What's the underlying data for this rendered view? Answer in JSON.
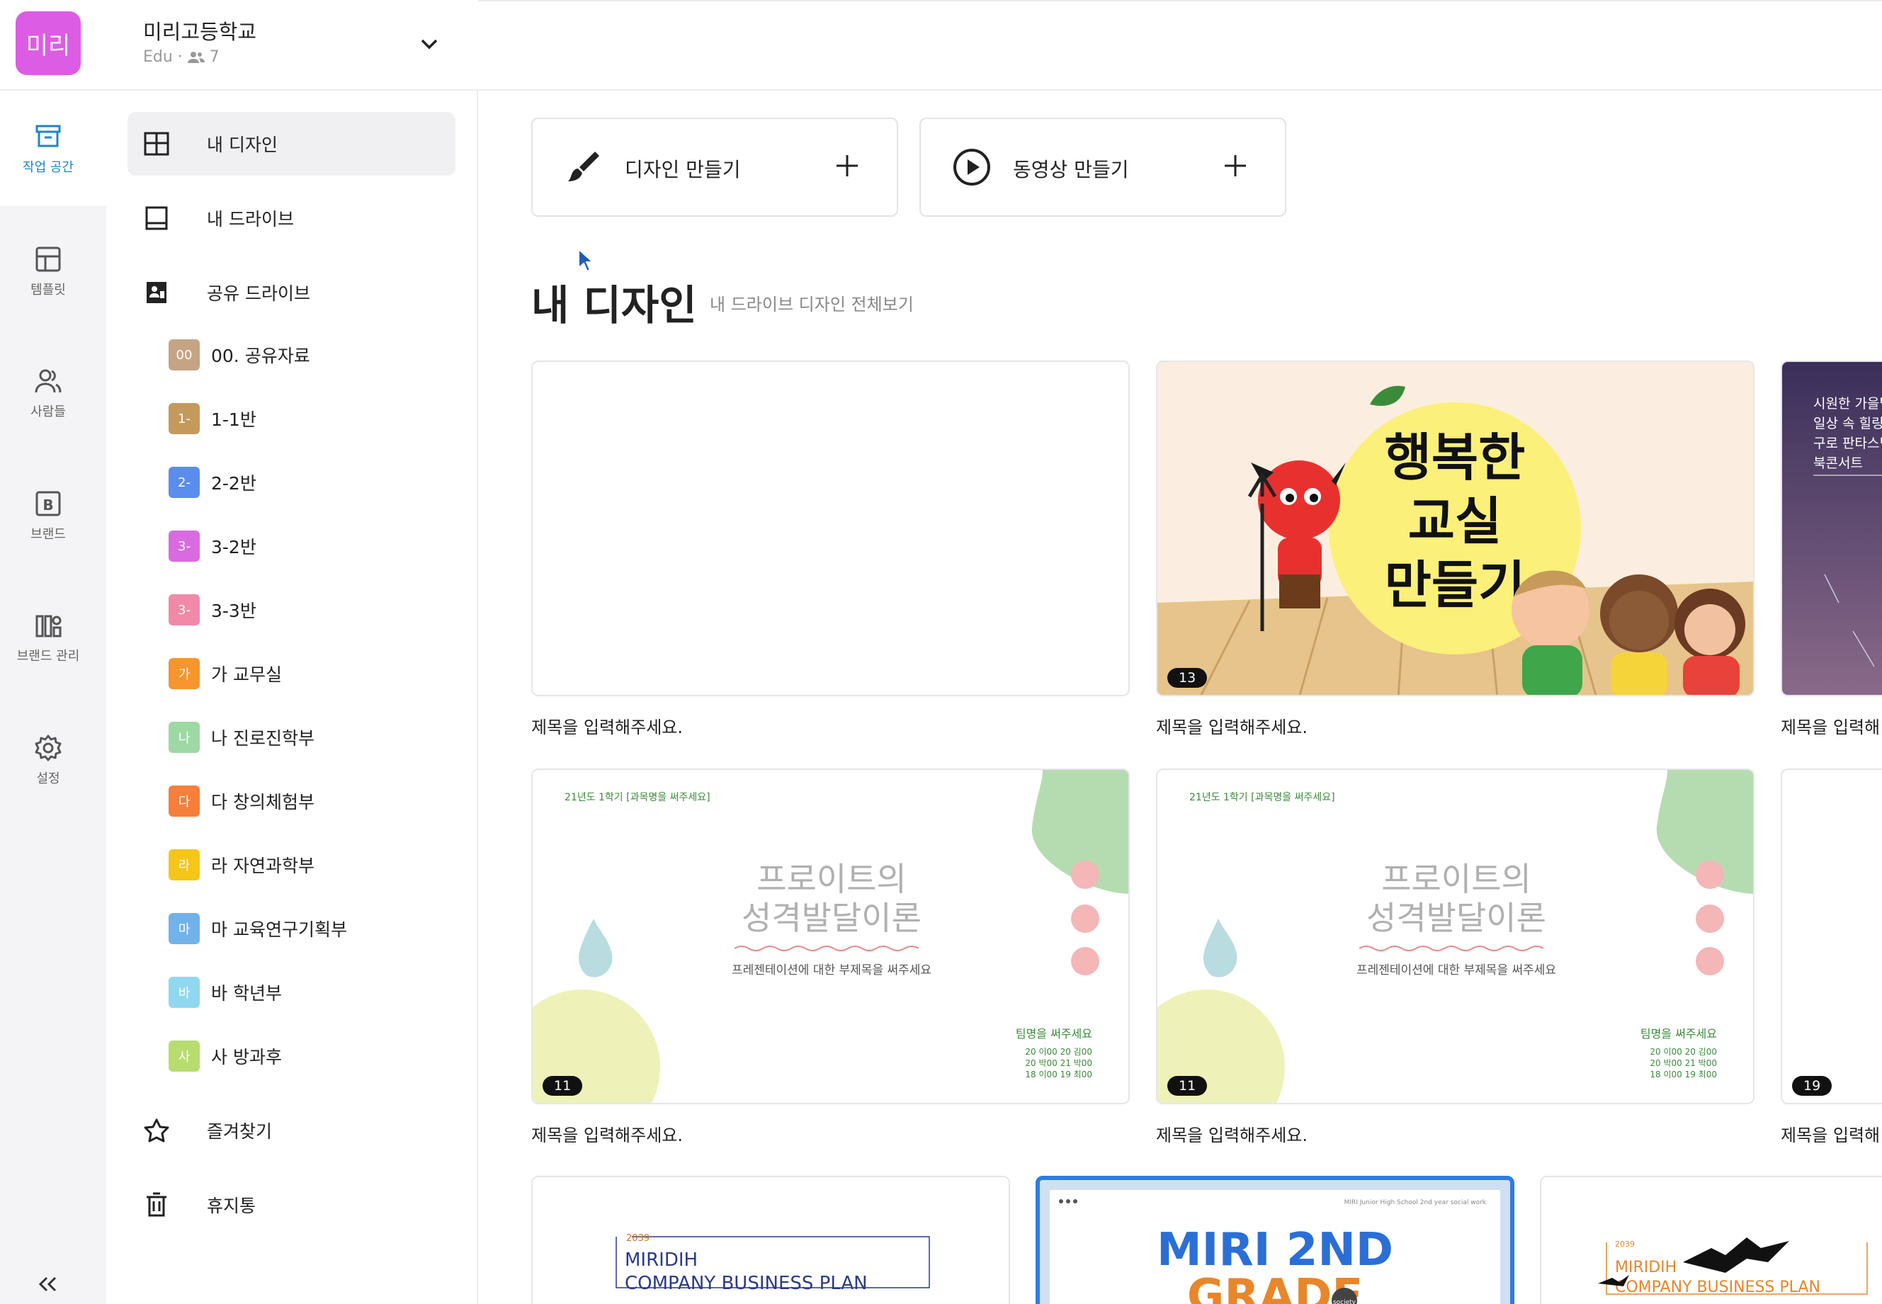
{
  "workspace": {
    "logo_text": "미리",
    "name": "미리고등학교",
    "plan": "Edu ·",
    "members": "7"
  },
  "rail": {
    "items": [
      {
        "label": "작업 공간",
        "icon": "archive-icon"
      },
      {
        "label": "템플릿",
        "icon": "template-icon"
      },
      {
        "label": "사람들",
        "icon": "people-icon"
      },
      {
        "label": "브랜드",
        "icon": "brand-b-icon"
      },
      {
        "label": "브랜드 관리",
        "icon": "brand-manage-icon"
      },
      {
        "label": "설정",
        "icon": "gear-icon"
      }
    ]
  },
  "nav": {
    "my_designs": "내 디자인",
    "my_drive": "내 드라이브",
    "shared_drive": "공유 드라이브",
    "favorites": "즐겨찾기",
    "trash": "휴지통",
    "folders": [
      {
        "badge": "00",
        "label": "00. 공유자료",
        "color": "#c4a484"
      },
      {
        "badge": "1-",
        "label": "1-1반",
        "color": "#c49a5c"
      },
      {
        "badge": "2-",
        "label": "2-2반",
        "color": "#5b8def"
      },
      {
        "badge": "3-",
        "label": "3-2반",
        "color": "#d86be0"
      },
      {
        "badge": "3-",
        "label": "3-3반",
        "color": "#f08aa8"
      },
      {
        "badge": "가",
        "label": "가 교무실",
        "color": "#f7952e"
      },
      {
        "badge": "나",
        "label": "나 진로진학부",
        "color": "#9ed8a4"
      },
      {
        "badge": "다",
        "label": "다 창의체험부",
        "color": "#f67f3c"
      },
      {
        "badge": "라",
        "label": "라 자연과학부",
        "color": "#f5c518"
      },
      {
        "badge": "마",
        "label": "마 교육연구기획부",
        "color": "#72b2ea"
      },
      {
        "badge": "바",
        "label": "바 학년부",
        "color": "#8fd8f0"
      },
      {
        "badge": "사",
        "label": "사 방과후",
        "color": "#b6dd6e"
      }
    ]
  },
  "main": {
    "create_design": "디자인 만들기",
    "create_video": "동영상 만들기",
    "section_title": "내 디자인",
    "section_link": "내 드라이브 디자인 전체보기",
    "designs": [
      {
        "title": "제목을 입력해주세요.",
        "count": ""
      },
      {
        "title": "제목을 입력해주세요.",
        "count": "13"
      },
      {
        "title": "제목을 입력해",
        "count": ""
      },
      {
        "title": "제목을 입력해주세요.",
        "count": "11"
      },
      {
        "title": "제목을 입력해주세요.",
        "count": "11"
      },
      {
        "title": "제목을 입력해",
        "count": "19"
      }
    ],
    "thumb_text": {
      "happy_l1": "행복한",
      "happy_l2": "교실",
      "happy_l3": "만들기",
      "dark_l1": "시원한 가을밤",
      "dark_l2": "일상 속 힐링",
      "dark_l3": "구로 판타스틱",
      "dark_l4": "북콘서트",
      "freud_top": "21년도 1학기 [과목명을 써주세요]",
      "freud_l1": "프로이트의",
      "freud_l2": "성격발달이론",
      "freud_sub": "프레젠테이션에 대한 부제목을 써주세요",
      "freud_team": "팀명을 써주세요",
      "freud_m1": "20 이00 20 김00",
      "freud_m2": "20 박00 21 박00",
      "freud_m3": "18 이00 19 최00",
      "biz_year": "2039",
      "biz_l1": "MIRIDIH",
      "biz_l2": "COMPANY BUSINESS PLAN",
      "grade_l1": "MIRI 2ND",
      "grade_l2": "GRADE",
      "grade_tag": "society",
      "grade_caption": "MIRI Junior High School 2nd year social work"
    }
  }
}
